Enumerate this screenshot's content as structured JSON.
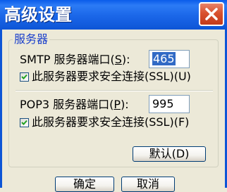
{
  "window": {
    "title": "高级设置"
  },
  "group": {
    "legend": "服务器"
  },
  "smtp": {
    "label_pre": "SMTP 服务器端口(",
    "label_key": "S",
    "label_post": "):",
    "port": "465",
    "ssl_label": "此服务器要求安全连接(SSL)(U)",
    "ssl_checked": true
  },
  "pop3": {
    "label_pre": "POP3 服务器端口(",
    "label_key": "P",
    "label_post": "):",
    "port": "995",
    "ssl_label": "此服务器要求安全连接(SSL)(F)",
    "ssl_checked": true
  },
  "buttons": {
    "default_label": "默认(D)",
    "ok_label": "确定",
    "cancel_label": "取消"
  },
  "icons": {
    "close": "close-icon",
    "check": "checkmark-icon"
  },
  "colors": {
    "titlebar": "#0D55D6",
    "legend": "#1A3FCB",
    "selection": "#316AC5",
    "close": "#D9512F"
  }
}
